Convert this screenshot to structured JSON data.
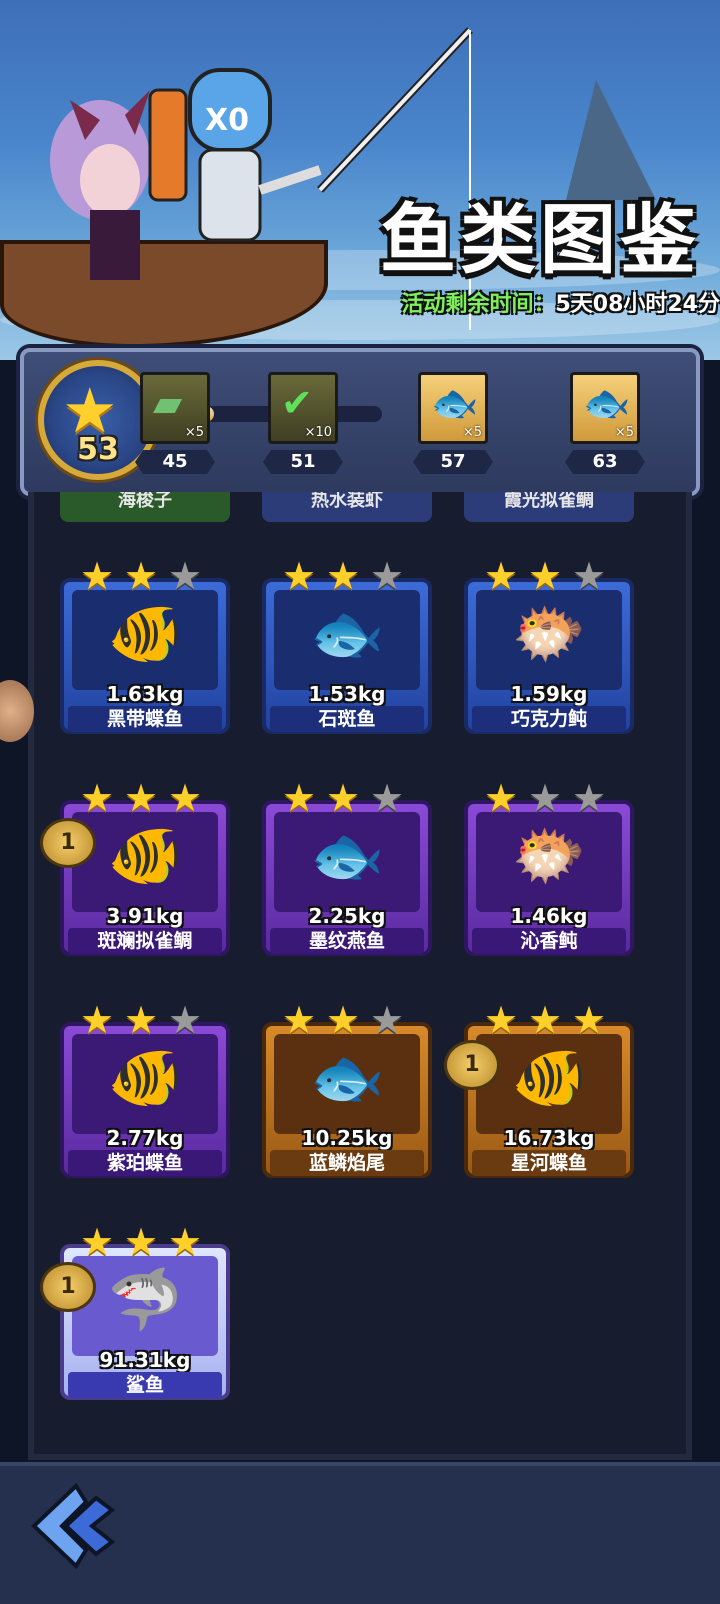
{
  "header": {
    "title": "鱼类图鉴",
    "timer_label": "活动剩余时间：",
    "timer_value": "5天08小时24分"
  },
  "progress": {
    "star_count": "53",
    "fill_fraction": 0.27,
    "rewards": [
      {
        "icon": "green-item-icon",
        "count": "×5",
        "threshold": "45"
      },
      {
        "icon": "checkmark-icon",
        "count": "×10",
        "threshold": "51"
      },
      {
        "icon": "fishing-lure-icon",
        "count": "×5",
        "threshold": "57"
      },
      {
        "icon": "fishing-lure-icon",
        "count": "×5",
        "threshold": "63"
      }
    ]
  },
  "partial_row": [
    "海梭子",
    "热水装虾",
    "霞光拟雀鲷"
  ],
  "fish": [
    {
      "name": "黑带蝶鱼",
      "weight": "1.63kg",
      "stars": 2,
      "rarity": "blue"
    },
    {
      "name": "石斑鱼",
      "weight": "1.53kg",
      "stars": 2,
      "rarity": "blue"
    },
    {
      "name": "巧克力鲀",
      "weight": "1.59kg",
      "stars": 2,
      "rarity": "blue"
    },
    {
      "name": "斑斓拟雀鲷",
      "weight": "3.91kg",
      "stars": 3,
      "rarity": "purple",
      "rank": "1"
    },
    {
      "name": "墨纹燕鱼",
      "weight": "2.25kg",
      "stars": 2,
      "rarity": "purple"
    },
    {
      "name": "沁香鲀",
      "weight": "1.46kg",
      "stars": 1,
      "rarity": "purple"
    },
    {
      "name": "紫珀蝶鱼",
      "weight": "2.77kg",
      "stars": 2,
      "rarity": "purple"
    },
    {
      "name": "蓝鳞焰尾",
      "weight": "10.25kg",
      "stars": 2,
      "rarity": "orange"
    },
    {
      "name": "星河蝶鱼",
      "weight": "16.73kg",
      "stars": 3,
      "rarity": "orange",
      "rank": "1"
    },
    {
      "name": "鲨鱼",
      "weight": "91.31kg",
      "stars": 3,
      "rarity": "shark",
      "rank": "1"
    }
  ],
  "colors": {
    "timer_label": "#7ef05a",
    "star_on": "#ffd02a",
    "star_off": "#9a9a9a"
  }
}
